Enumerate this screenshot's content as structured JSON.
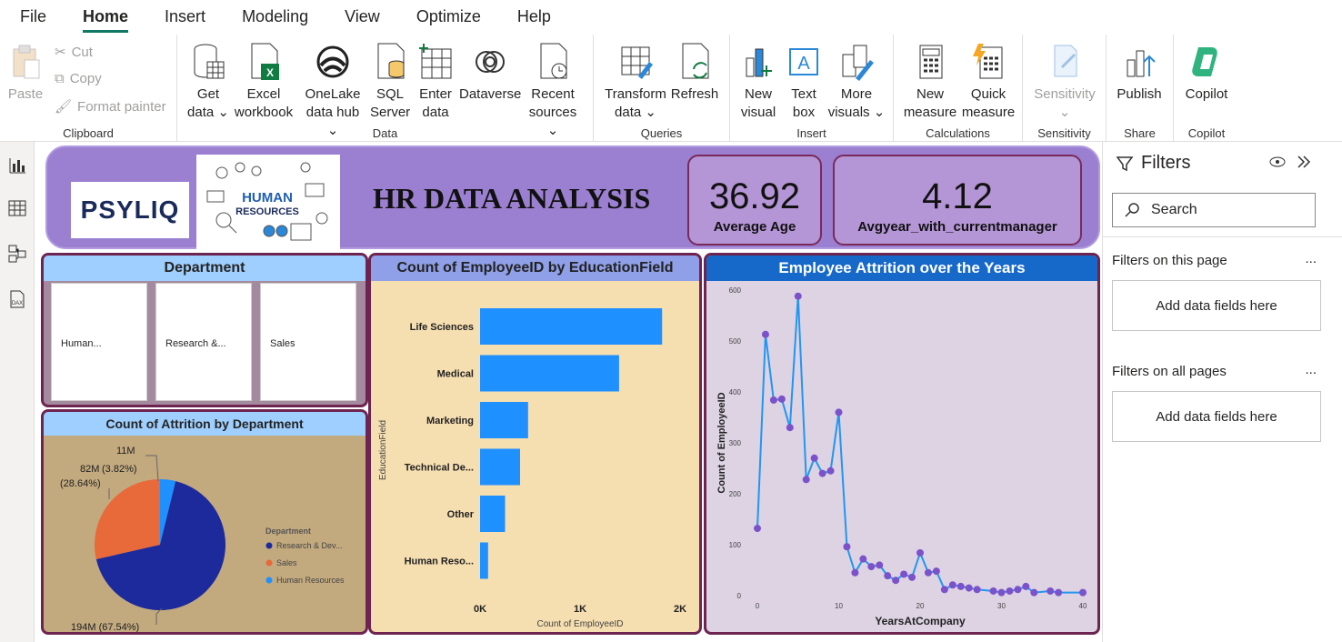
{
  "menu": [
    "File",
    "Home",
    "Insert",
    "Modeling",
    "View",
    "Optimize",
    "Help"
  ],
  "ribbon": {
    "clipboard": {
      "paste": "Paste",
      "cut": "Cut",
      "copy": "Copy",
      "format_painter": "Format painter",
      "label": "Clipboard"
    },
    "data": {
      "get_data": [
        "Get",
        "data"
      ],
      "excel": [
        "Excel",
        "workbook"
      ],
      "onelake": [
        "OneLake",
        "data hub"
      ],
      "sql": [
        "SQL",
        "Server"
      ],
      "enter": [
        "Enter",
        "data"
      ],
      "dataverse": "Dataverse",
      "recent": [
        "Recent",
        "sources"
      ],
      "label": "Data"
    },
    "queries": {
      "transform": [
        "Transform",
        "data"
      ],
      "refresh": "Refresh",
      "label": "Queries"
    },
    "insert": {
      "new_visual": [
        "New",
        "visual"
      ],
      "text_box": [
        "Text",
        "box"
      ],
      "more_visuals": [
        "More",
        "visuals"
      ],
      "label": "Insert"
    },
    "calculations": {
      "new_measure": [
        "New",
        "measure"
      ],
      "quick_measure": [
        "Quick",
        "measure"
      ],
      "label": "Calculations"
    },
    "sensitivity": {
      "btn": "Sensitivity",
      "label": "Sensitivity"
    },
    "share": {
      "publish": "Publish",
      "label": "Share"
    },
    "copilot": {
      "btn": "Copilot",
      "label": "Copilot"
    }
  },
  "report": {
    "logo_text": "PSYLIQ",
    "hr_img_text": [
      "HUMAN",
      "RESOURCES"
    ],
    "title": "HR DATA ANALYSIS",
    "kpis": [
      {
        "value": "36.92",
        "label": "Average Age"
      },
      {
        "value": "4.12",
        "label": "Avgyear_with_currentmanager"
      }
    ],
    "department": {
      "title": "Department",
      "tiles": [
        "Human...",
        "Research &...",
        "Sales"
      ]
    },
    "attrition": {
      "title": "Count of Attrition by Department"
    },
    "education": {
      "title": "Count of EmployeeID by EducationField"
    },
    "trend": {
      "title": "Employee Attrition over the Years"
    }
  },
  "filters": {
    "title": "Filters",
    "search_placeholder": "Search",
    "on_page": "Filters on this page",
    "on_all": "Filters on all pages",
    "add_fields": "Add data fields here",
    "more": "..."
  },
  "colors": {
    "accent": "#117865",
    "header_purple": "#9b7fd0",
    "kpi_purple": "#b495d6",
    "pie_navy": "#1c2a9c",
    "pie_orange": "#e8693a",
    "pie_blue": "#1e90ff",
    "bar_blue": "#1e90ff",
    "line_blue": "#2196f3",
    "dot_purple": "#7b52c9"
  },
  "chart_data": [
    {
      "type": "pie",
      "title": "Count of Attrition by Department",
      "legend_title": "Department",
      "legend_position": "right",
      "categories": [
        "Research & Dev...",
        "Sales",
        "Human Resources"
      ],
      "values": [
        194,
        82,
        11
      ],
      "labels": [
        "194M (67.54%)",
        "82M (28.64%)",
        "11M (3.82%)"
      ],
      "colors": [
        "#1c2a9c",
        "#e8693a",
        "#1e90ff"
      ]
    },
    {
      "type": "bar",
      "orientation": "horizontal",
      "title": "Count of EmployeeID by EducationField",
      "categories": [
        "Life Sciences",
        "Medical",
        "Marketing",
        "Technical De...",
        "Other",
        "Human Reso..."
      ],
      "values": [
        1820,
        1390,
        480,
        400,
        250,
        80
      ],
      "xlabel": "Count of EmployeeID",
      "ylabel": "EducationField",
      "xticks": [
        "0K",
        "1K",
        "2K"
      ],
      "xlim": [
        0,
        2000
      ]
    },
    {
      "type": "line",
      "title": "Employee Attrition over the Years",
      "xlabel": "YearsAtCompany",
      "ylabel": "Count of EmployeeID",
      "xticks": [
        0,
        10,
        20,
        30,
        40
      ],
      "yticks": [
        0,
        100,
        200,
        300,
        400,
        500,
        600
      ],
      "xlim": [
        0,
        40
      ],
      "ylim": [
        0,
        600
      ],
      "x": [
        0,
        1,
        2,
        3,
        4,
        5,
        6,
        7,
        8,
        9,
        10,
        11,
        12,
        13,
        14,
        15,
        16,
        17,
        18,
        19,
        20,
        21,
        22,
        23,
        24,
        25,
        26,
        27,
        29,
        30,
        31,
        32,
        33,
        34,
        36,
        37,
        40
      ],
      "y": [
        132,
        513,
        384,
        386,
        330,
        588,
        228,
        270,
        240,
        245,
        360,
        96,
        45,
        72,
        57,
        60,
        39,
        30,
        42,
        36,
        84,
        45,
        48,
        12,
        21,
        18,
        15,
        12,
        9,
        6,
        9,
        12,
        18,
        6,
        9,
        6,
        6
      ]
    }
  ]
}
